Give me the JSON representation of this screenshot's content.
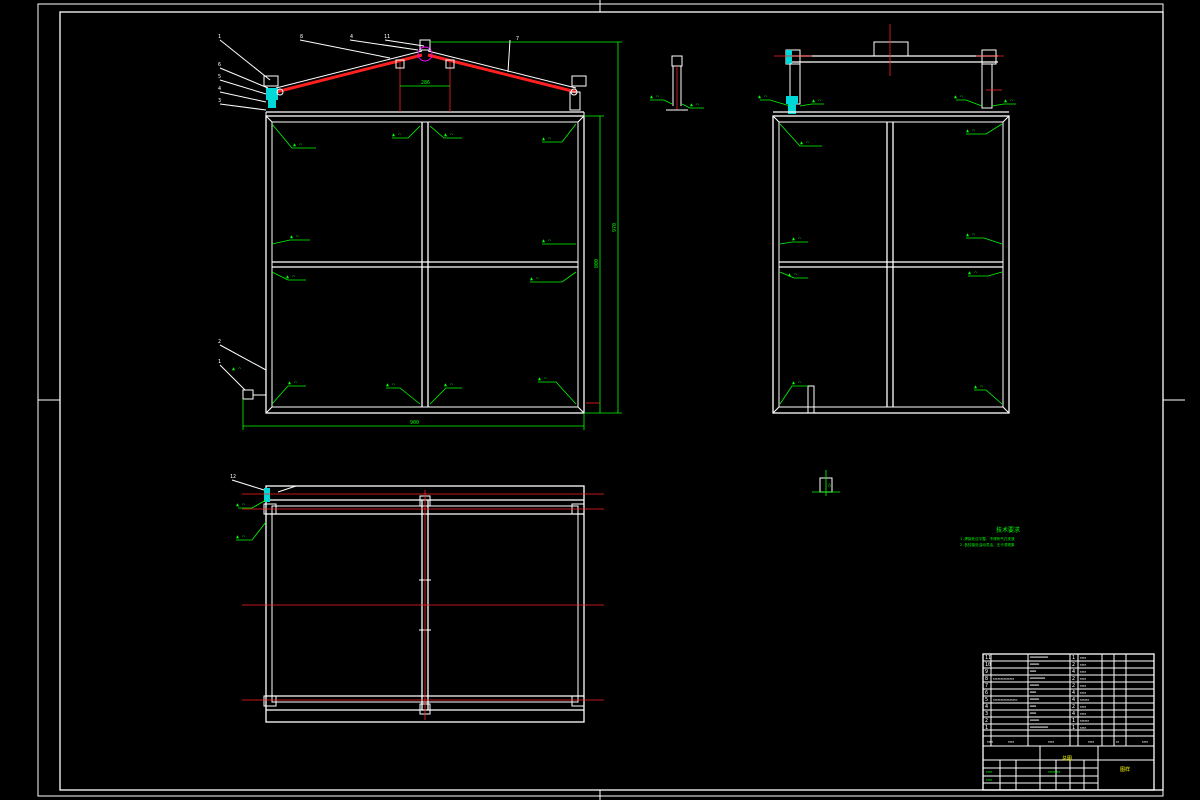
{
  "drawing": {
    "background": "#000000",
    "line_color": "#ffffff",
    "dimension_color": "#00ff00",
    "center_line_color": "#ff2020",
    "highlight_color": "#00d8d8"
  },
  "title_block": {
    "drawing_name": "总图",
    "scale_cell": "图样",
    "parts_rows": 11
  },
  "notes": {
    "title": "技术要求",
    "lines": [
      "1.焊接处应平整，不得有气孔夹渣",
      "2.各铰接处活动灵活，无卡滞现象"
    ]
  }
}
